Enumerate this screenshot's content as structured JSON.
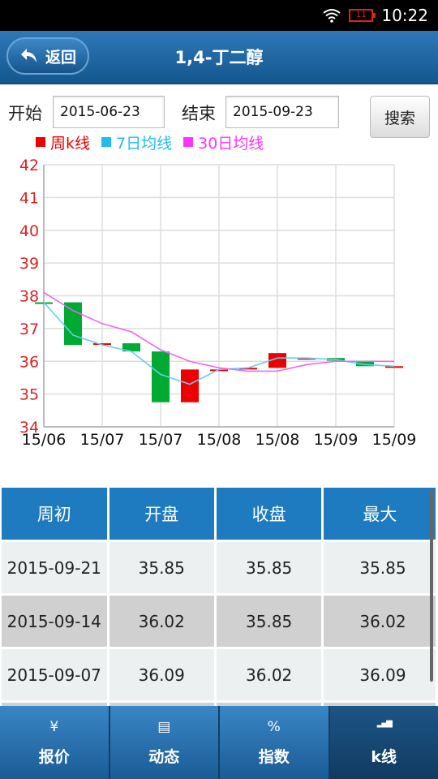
{
  "status_bar": {
    "time": "10:22",
    "battery": "11"
  },
  "header": {
    "back_label": "返回",
    "title": "1,4-丁二醇"
  },
  "search": {
    "start_label": "开始",
    "start_value": "2015-06-23",
    "end_label": "结束",
    "end_value": "2015-09-23",
    "search_label": "搜索"
  },
  "legend": [
    {
      "label": "周k线",
      "color": "#ee0000"
    },
    {
      "label": "7日均线",
      "color": "#22bbee"
    },
    {
      "label": "30日均线",
      "color": "#ff33ff"
    }
  ],
  "chart_data": {
    "type": "candlestick",
    "x_tick_labels": [
      "15/06",
      "15/07",
      "15/07",
      "15/08",
      "15/08",
      "15/09",
      "15/09"
    ],
    "ylim": [
      34,
      42
    ],
    "y_ticks": [
      34,
      35,
      36,
      37,
      38,
      39,
      40,
      41,
      42
    ],
    "grid": true,
    "colors": {
      "up": "#ee0000",
      "down": "#00aa33",
      "ma7": "#66ccee",
      "ma30": "#ee66ee",
      "axis_text": "#dd2222"
    },
    "candles": [
      {
        "open": 37.8,
        "close": 37.75
      },
      {
        "open": 37.8,
        "close": 36.5
      },
      {
        "open": 36.55,
        "close": 36.55
      },
      {
        "open": 36.55,
        "close": 36.3
      },
      {
        "open": 36.3,
        "close": 34.75
      },
      {
        "open": 34.75,
        "close": 35.75
      },
      {
        "open": 35.75,
        "close": 35.75
      },
      {
        "open": 35.8,
        "close": 35.8
      },
      {
        "open": 35.8,
        "close": 36.25
      },
      {
        "open": 36.1,
        "close": 36.1
      },
      {
        "open": 36.1,
        "close": 36.02
      },
      {
        "open": 36.02,
        "close": 35.85
      },
      {
        "open": 35.85,
        "close": 35.85
      }
    ],
    "series": [
      {
        "name": "7日均线",
        "values": [
          37.8,
          36.8,
          36.5,
          36.3,
          35.6,
          35.3,
          35.75,
          35.8,
          36.1,
          36.1,
          36.05,
          35.9,
          35.85
        ]
      },
      {
        "name": "30日均线",
        "values": [
          38.1,
          37.55,
          37.15,
          36.9,
          36.35,
          36.0,
          35.8,
          35.7,
          35.7,
          35.9,
          36.0,
          36.0,
          36.0
        ]
      }
    ]
  },
  "table": {
    "headers": [
      "周初",
      "开盘",
      "收盘",
      "最大"
    ],
    "rows": [
      [
        "2015-09-21",
        "35.85",
        "35.85",
        "35.85"
      ],
      [
        "2015-09-14",
        "36.02",
        "35.85",
        "36.02"
      ],
      [
        "2015-09-07",
        "36.09",
        "36.02",
        "36.09"
      ],
      [
        "",
        "",
        "",
        ""
      ]
    ]
  },
  "nav": [
    {
      "label": "报价",
      "icon": "¥",
      "icon_name": "yen-icon"
    },
    {
      "label": "动态",
      "icon": "▤",
      "icon_name": "news-icon"
    },
    {
      "label": "指数",
      "icon": "%",
      "icon_name": "percent-icon"
    },
    {
      "label": "k线",
      "icon": "▂▄▆",
      "icon_name": "kline-icon"
    }
  ]
}
